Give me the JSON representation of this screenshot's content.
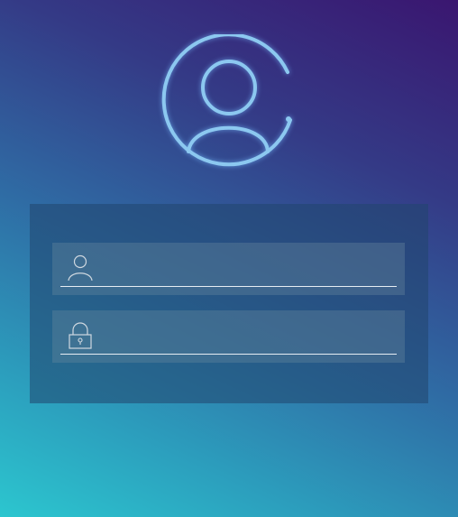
{
  "avatar": {
    "icon": "user-circle-icon"
  },
  "login_form": {
    "username": {
      "icon": "person-icon",
      "value": "",
      "placeholder": ""
    },
    "password": {
      "icon": "padlock-icon",
      "value": "",
      "placeholder": ""
    }
  },
  "colors": {
    "background_top": "#3a1670",
    "background_bottom": "#2cc6cf",
    "avatar_stroke": "#8cc8f0",
    "underline": "#e6edf3"
  }
}
